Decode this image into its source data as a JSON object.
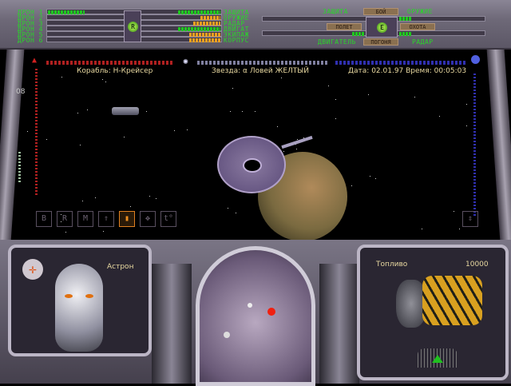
{
  "top_panel": {
    "drones": [
      "ДРОН 1",
      "ДРОН 2",
      "ДРОН 3",
      "ДРОН 4",
      "ДРОН 5",
      "ДРОН 6"
    ],
    "systems": [
      {
        "label": "ЗАЩИТА",
        "level": 0.95,
        "color": "#1fc81f"
      },
      {
        "label": "ОРУЖИЕ",
        "level": 0.45,
        "color": "#f0a020"
      },
      {
        "label": "РАДАР",
        "level": 0.6,
        "color": "#f0a020"
      },
      {
        "label": "ДВИГАТ",
        "level": 0.95,
        "color": "#1fc81f"
      },
      {
        "label": "ЭКИПАЖ",
        "level": 0.7,
        "color": "#f0a020"
      },
      {
        "label": "КОРПУС",
        "level": 0.7,
        "color": "#f0a020"
      }
    ],
    "drone1_level": 0.5,
    "center_knob_left": "R",
    "center_knob_right": "E",
    "modes": {
      "fight": "БОЙ",
      "flight": "ПОЛЕТ",
      "hunt": "ОХОТА",
      "chase": "ПОГОНЯ"
    },
    "priority_labels": {
      "shield": "ЗАЩИТА",
      "weapon": "ОРУЖИЕ",
      "engine": "ДВИГАТЕЛЬ",
      "radar": "РАДАР"
    }
  },
  "hud": {
    "ship": "Корабль: Н-Крейсер",
    "star": "Звезда: α Ловей ЖЕЛТЫЙ",
    "datetime": "Дата: 02.01.97 Время: 00:05:03",
    "speed": "08",
    "action_icons": [
      "B",
      "R",
      "M",
      "ship",
      "active",
      "move",
      "t°"
    ]
  },
  "cockpit": {
    "pilot_name": "Астрон",
    "fuel_label": "Топливо",
    "fuel_value": "10000"
  },
  "colors": {
    "hud_text": "#e8d8a0",
    "green": "#1fc81f",
    "orange": "#f0a020"
  }
}
